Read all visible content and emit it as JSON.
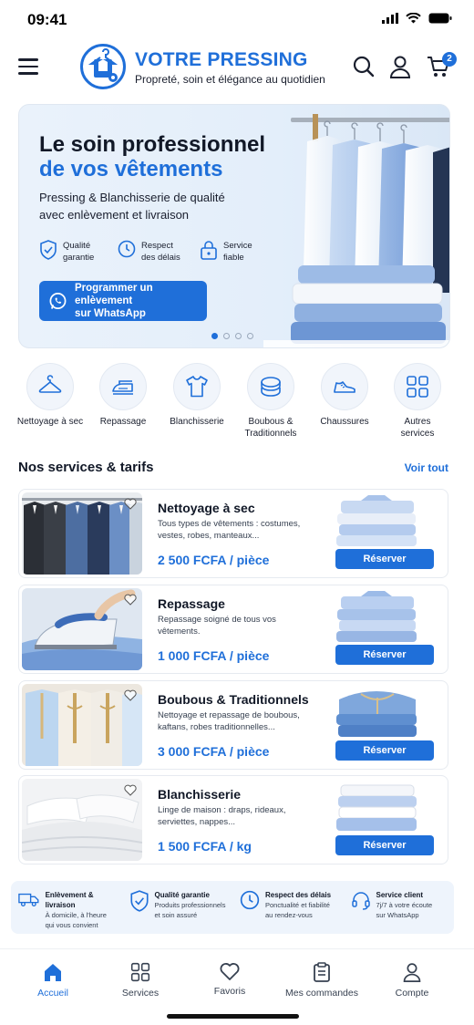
{
  "status_bar": {
    "time": "09:41"
  },
  "header": {
    "brand_name": "VOTRE PRESSING",
    "tagline": "Propreté, soin et élégance au quotidien",
    "cart_count": "2",
    "icons": [
      "menu-icon",
      "search-icon",
      "user-icon",
      "cart-icon"
    ]
  },
  "hero": {
    "title_line1": "Le soin professionnel",
    "title_line2": "de vos vêtements",
    "subtitle_line1": "Pressing & Blanchisserie de qualité",
    "subtitle_line2": "avec enlèvement et livraison",
    "features": [
      {
        "line1": "Qualité",
        "line2": "garantie",
        "icon": "shield-check-icon"
      },
      {
        "line1": "Respect",
        "line2": "des délais",
        "icon": "clock-icon"
      },
      {
        "line1": "Service",
        "line2": "fiable",
        "icon": "lock-icon"
      }
    ],
    "cta_line1": "Programmer un enlèvement",
    "cta_line2": "sur WhatsApp",
    "carousel_active_index": 0,
    "carousel_count": 4
  },
  "categories": [
    {
      "line1": "Nettoyage à sec",
      "line2": "",
      "icon": "hanger-icon"
    },
    {
      "line1": "Repassage",
      "line2": "",
      "icon": "iron-icon"
    },
    {
      "line1": "Blanchisserie",
      "line2": "",
      "icon": "shirt-icon"
    },
    {
      "line1": "Boubous &",
      "line2": "Traditionnels",
      "icon": "folded-clothes-icon"
    },
    {
      "line1": "Chaussures",
      "line2": "",
      "icon": "shoe-icon"
    },
    {
      "line1": "Autres",
      "line2": "services",
      "icon": "grid-icon"
    }
  ],
  "services_section": {
    "title": "Nos services & tarifs",
    "see_all": "Voir tout",
    "items": [
      {
        "title": "Nettoyage à sec",
        "desc": "Tous types de vêtements : costumes, vestes, robes, manteaux...",
        "price": "2 500 FCFA / pièce",
        "button": "Réserver"
      },
      {
        "title": "Repassage",
        "desc": "Repassage soigné de tous vos vêtements.",
        "price": "1 000 FCFA / pièce",
        "button": "Réserver"
      },
      {
        "title": "Boubous & Traditionnels",
        "desc": "Nettoyage et repassage de boubous, kaftans, robes traditionnelles...",
        "price": "3 000 FCFA / pièce",
        "button": "Réserver"
      },
      {
        "title": "Blanchisserie",
        "desc": "Linge de maison : draps, rideaux, serviettes, nappes...",
        "price": "1 500 FCFA / kg",
        "button": "Réserver"
      }
    ]
  },
  "features_bar": [
    {
      "title": "Enlèvement & livraison",
      "desc1": "À domicile, à l'heure",
      "desc2": "qui vous convient",
      "icon": "truck-icon"
    },
    {
      "title": "Qualité garantie",
      "desc1": "Produits professionnels",
      "desc2": "et soin assuré",
      "icon": "shield-check-icon"
    },
    {
      "title": "Respect des délais",
      "desc1": "Ponctualité et fiabilité",
      "desc2": "au rendez-vous",
      "icon": "clock-icon"
    },
    {
      "title": "Service client",
      "desc1": "7j/7 à votre écoute",
      "desc2": "sur WhatsApp",
      "icon": "headset-icon"
    }
  ],
  "bottom_nav": [
    {
      "label": "Accueil",
      "icon": "home-icon",
      "active": true
    },
    {
      "label": "Services",
      "icon": "grid-icon",
      "active": false
    },
    {
      "label": "Favoris",
      "icon": "heart-icon",
      "active": false
    },
    {
      "label": "Mes commandes",
      "icon": "clipboard-icon",
      "active": false
    },
    {
      "label": "Compte",
      "icon": "user-icon",
      "active": false
    }
  ],
  "colors": {
    "accent": "#1f6fd9",
    "text": "#111827",
    "hero_bg": "#e6f0fb"
  }
}
